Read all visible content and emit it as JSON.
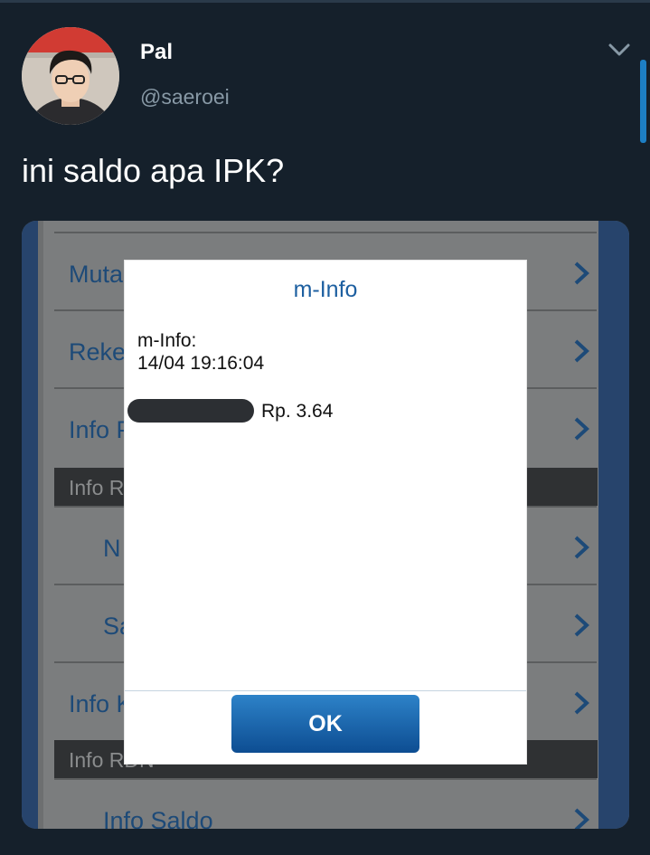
{
  "tweet": {
    "author_name": "Pal",
    "author_handle": "@saeroei",
    "text": "ini saldo apa IPK?",
    "menu_icon": "chevron-down-icon",
    "colors": {
      "background": "#15202b",
      "name": "#ffffff",
      "handle": "#8899a6",
      "accent": "#1d7fc4"
    }
  },
  "screenshot": {
    "menu_rows": [
      {
        "label": "Muta",
        "icon": "chevron-right-icon"
      },
      {
        "label": "Reke",
        "icon": "chevron-right-icon"
      },
      {
        "label": "Info P",
        "icon": "chevron-right-icon"
      },
      {
        "label": "N",
        "icon": "chevron-right-icon"
      },
      {
        "label": "Sa",
        "icon": "chevron-right-icon"
      },
      {
        "label": "Info K",
        "icon": "chevron-right-icon"
      },
      {
        "label": "Info Saldo",
        "icon": "chevron-right-icon"
      }
    ],
    "sections": [
      {
        "label": "Info R"
      },
      {
        "label": "Info RDN"
      }
    ],
    "dialog": {
      "title": "m-Info",
      "line1": "m-Info:",
      "line2": "14/04 19:16:04",
      "amount": "Rp. 3.64",
      "ok_label": "OK",
      "colors": {
        "title": "#1d5fa0",
        "button": "#1a68b0"
      }
    }
  }
}
